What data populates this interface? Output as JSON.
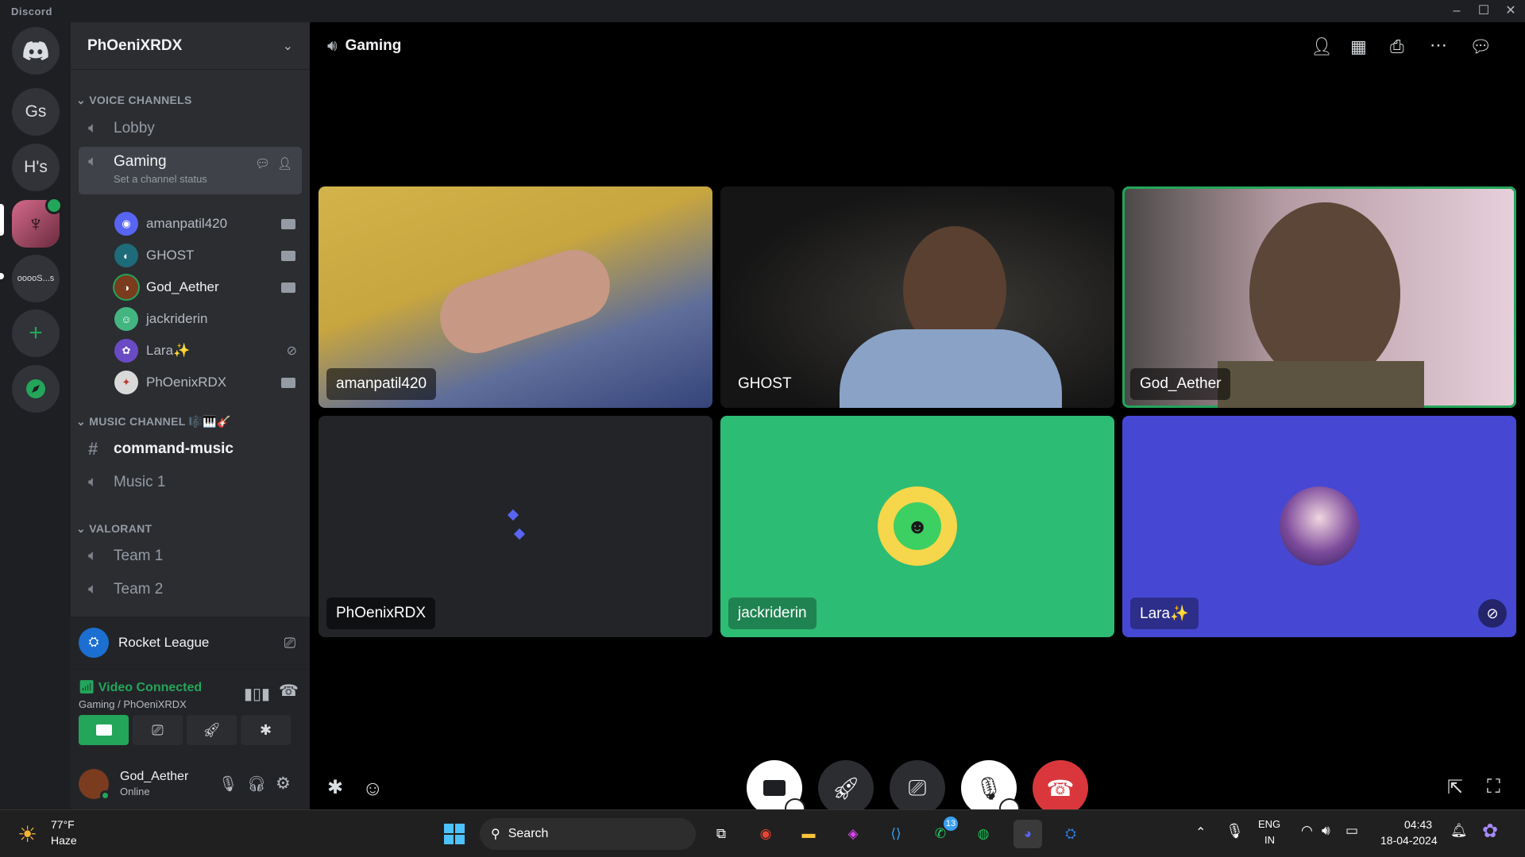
{
  "window": {
    "title": "Discord"
  },
  "servers": [
    {
      "label": "Gs"
    },
    {
      "label": "H's"
    },
    {
      "label": "ooooS...s"
    }
  ],
  "guild": {
    "name": "PhOeniXRDX"
  },
  "categories": {
    "voice": "VOICE CHANNELS",
    "music": "MUSIC CHANNEL",
    "valorant": "VALORANT"
  },
  "channels": {
    "lobby": "Lobby",
    "gaming": "Gaming",
    "gaming_status": "Set a channel status",
    "command_music": "command-music",
    "music1": "Music 1",
    "team1": "Team 1",
    "team2": "Team 2"
  },
  "members": [
    {
      "name": "amanpatil420",
      "color": "#5865f2"
    },
    {
      "name": "GHOST",
      "color": "#1e6b7a"
    },
    {
      "name": "God_Aether",
      "color": "#7a3b1e"
    },
    {
      "name": "jackriderin",
      "color": "#43b581"
    },
    {
      "name": "Lara✨",
      "color": "#6a4bc4"
    },
    {
      "name": "PhOenixRDX",
      "color": "#d9d9d9"
    }
  ],
  "activity": {
    "game": "Rocket League"
  },
  "voice": {
    "status": "Video Connected",
    "location": "Gaming / PhOeniXRDX"
  },
  "user": {
    "name": "God_Aether",
    "status": "Online"
  },
  "main": {
    "channel": "Gaming"
  },
  "tiles": [
    {
      "name": "amanpatil420"
    },
    {
      "name": "GHOST"
    },
    {
      "name": "God_Aether"
    },
    {
      "name": "PhOenixRDX"
    },
    {
      "name": "jackriderin"
    },
    {
      "name": "Lara✨"
    }
  ],
  "taskbar": {
    "weather_temp": "77°F",
    "weather_desc": "Haze",
    "search": "Search",
    "lang1": "ENG",
    "lang2": "IN",
    "time": "04:43",
    "date": "18-04-2024",
    "whatsapp_badge": "13"
  },
  "colors": {
    "green": "#23a55a",
    "red": "#da373c",
    "blurple": "#5865f2"
  }
}
